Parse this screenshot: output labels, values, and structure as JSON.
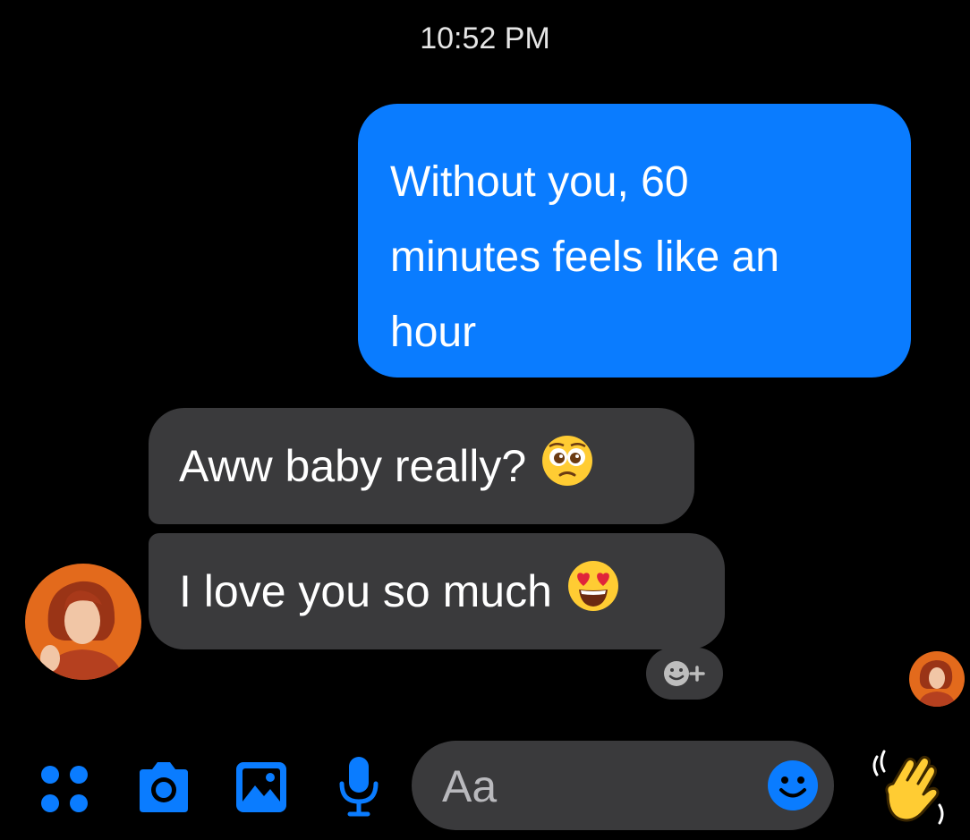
{
  "thread": {
    "timestamp": "10:52 PM",
    "messages": [
      {
        "direction": "outgoing",
        "lines": [
          "Without you, 60",
          "minutes feels like an",
          "hour"
        ]
      },
      {
        "direction": "incoming",
        "text": "Aww baby really?",
        "emoji": "pleading-face"
      },
      {
        "direction": "incoming",
        "text": "I love you so much",
        "emoji": "heart-eyes-face"
      }
    ]
  },
  "composer": {
    "placeholder": "Aa"
  },
  "colors": {
    "background": "#000000",
    "accent": "#0a7cff",
    "incoming_bubble": "#3a3a3c",
    "emoji_yellow": "#ffcc33"
  },
  "icons": [
    "apps-grid-icon",
    "camera-icon",
    "gallery-icon",
    "microphone-icon",
    "smiley-icon",
    "waving-hand-icon",
    "add-reaction-icon"
  ]
}
